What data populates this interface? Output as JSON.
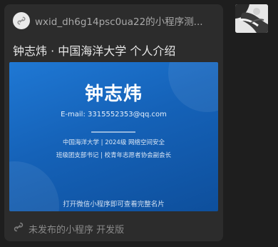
{
  "card": {
    "app_icon": "link-icon",
    "app_name": "wxid_dh6g14psc0ua22的小程序测...",
    "title": "钟志炜 · 中国海洋大学 个人介绍",
    "preview": {
      "name": "钟志炜",
      "email": "E-mail: 3315552353@qq.com",
      "info_line_1": "中国海洋大学 | 2024级 网络空间安全",
      "info_line_2": "班级团支部书记 | 校青年志愿者协会副会长",
      "hint": "打开微信小程序即可查看完整名片",
      "gradient_color": "#1a6cc8"
    },
    "footer_icon": "link-icon",
    "footer_text": "未发布的小程序 开发版"
  },
  "avatar": {
    "alt": "avatar"
  },
  "colors": {
    "background": "#1e1e1e",
    "card": "#2c2c2c",
    "accent_blue": "#1a6cc8"
  }
}
